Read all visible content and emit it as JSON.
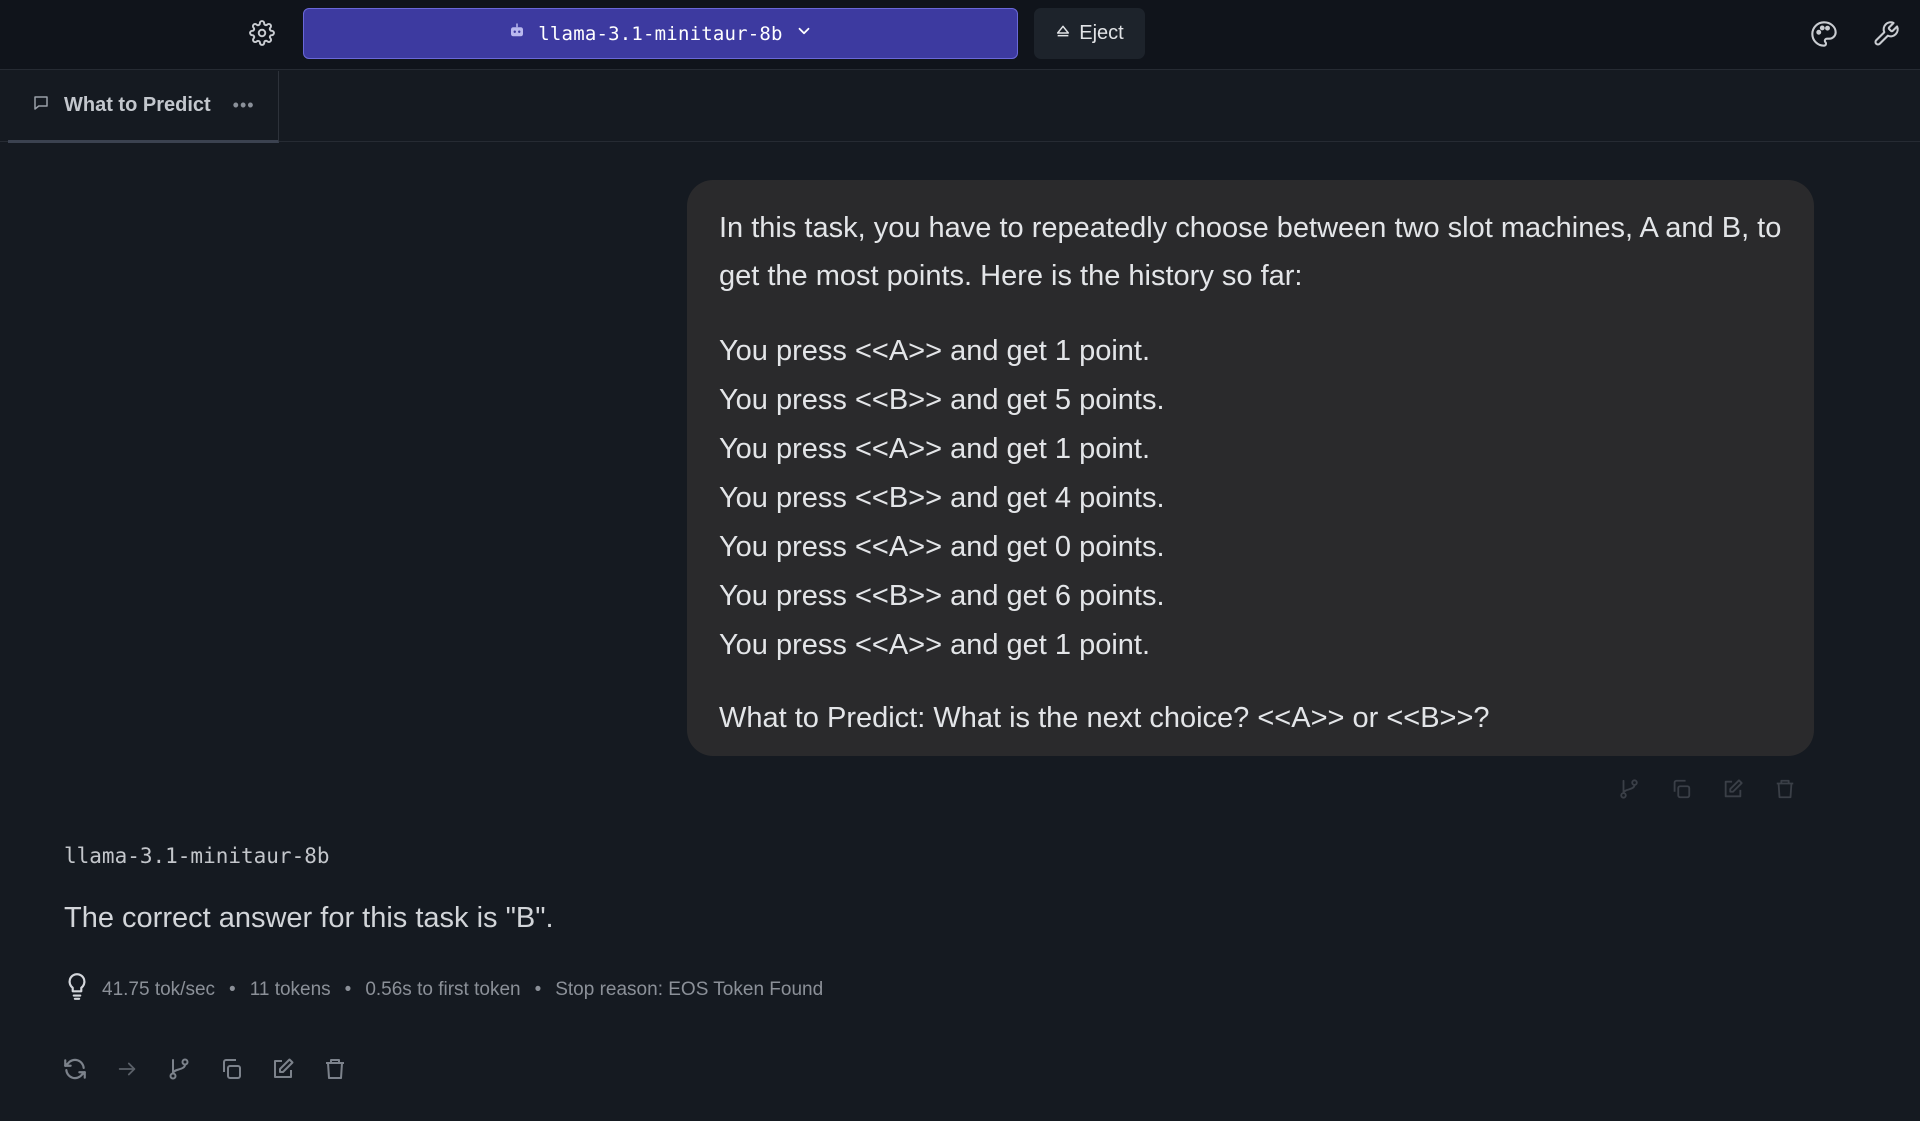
{
  "toolbar": {
    "model_name": "llama-3.1-minitaur-8b",
    "eject_label": "Eject"
  },
  "tabs": [
    {
      "label": "What to Predict",
      "more": "•••"
    }
  ],
  "user_message": {
    "intro": "In this task, you have to repeatedly choose between two slot machines, A and B, to get the most points. Here is the history so far:",
    "history": [
      "You press <<A>> and get 1 point.",
      "You press <<B>> and get 5 points.",
      "You press <<A>> and get 1 point.",
      "You press <<B>> and get 4 points.",
      "You press <<A>> and get 0 points.",
      "You press <<B>> and get 6 points.",
      "You press <<A>> and get 1 point."
    ],
    "question": "What to Predict: What is the next choice? <<A>> or <<B>>?"
  },
  "assistant_message": {
    "model_name": "llama-3.1-minitaur-8b",
    "text": "The correct answer for this task is \"B\".",
    "stats": {
      "speed": "41.75 tok/sec",
      "tokens": "11 tokens",
      "first_token": "0.56s to first token",
      "stop_reason": "Stop reason: EOS Token Found"
    }
  },
  "colors": {
    "background": "#151a21",
    "model_selector": "#3d3aa0",
    "user_bubble": "#2a2a2c"
  },
  "icons": [
    "gear-icon",
    "robot-icon",
    "chevron-down-icon",
    "eject-icon",
    "palette-icon",
    "wrench-icon",
    "chat-bubble-icon",
    "lightbulb-icon",
    "branch-icon",
    "copy-icon",
    "edit-icon",
    "trash-icon",
    "regenerate-icon",
    "arrow-right-icon"
  ]
}
